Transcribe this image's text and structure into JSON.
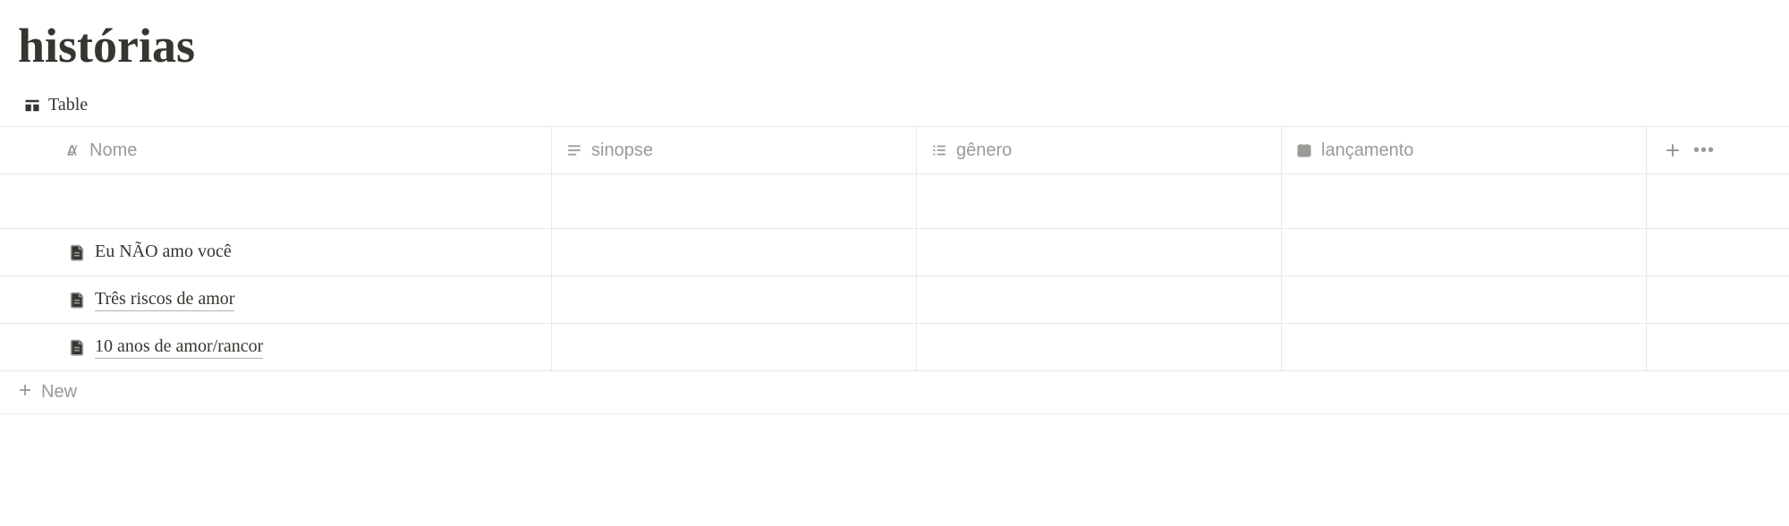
{
  "page": {
    "title": "histórias"
  },
  "view": {
    "current_label": "Table"
  },
  "columns": {
    "nome": "Nome",
    "sinopse": "sinopse",
    "genero": "gênero",
    "lancamento": "lançamento"
  },
  "rows": [
    {
      "nome": "",
      "sinopse": "",
      "genero": "",
      "lancamento": "",
      "empty": true
    },
    {
      "nome": "Eu NÃO amo você",
      "sinopse": "",
      "genero": "",
      "lancamento": "",
      "underline": false
    },
    {
      "nome": "Três riscos de amor",
      "sinopse": "",
      "genero": "",
      "lancamento": "",
      "underline": true
    },
    {
      "nome": "10 anos de amor/rancor",
      "sinopse": "",
      "genero": "",
      "lancamento": "",
      "underline": true
    }
  ],
  "new_label": "New"
}
